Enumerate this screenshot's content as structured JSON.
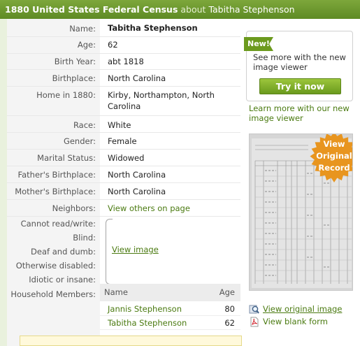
{
  "header": {
    "title": "1880 United States Federal Census",
    "about": "about",
    "person": "Tabitha Stephenson"
  },
  "record": [
    {
      "label": "Name:",
      "value": "Tabitha Stephenson"
    },
    {
      "label": "Age:",
      "value": "62"
    },
    {
      "label": "Birth Year:",
      "value": "abt 1818"
    },
    {
      "label": "Birthplace:",
      "value": "North Carolina"
    },
    {
      "label": "Home in 1880:",
      "value": "Kirby, Northampton, North Carolina"
    },
    {
      "label": "Race:",
      "value": "White"
    },
    {
      "label": "Gender:",
      "value": "Female"
    },
    {
      "label": "Marital Status:",
      "value": "Widowed"
    },
    {
      "label": "Father's Birthplace:",
      "value": "North Carolina"
    },
    {
      "label": "Mother's Birthplace:",
      "value": "North Carolina"
    },
    {
      "label": "Neighbors:",
      "value": "View others on page"
    }
  ],
  "disabilities": {
    "labels": [
      "Cannot read/write:",
      "Blind:",
      "Deaf and dumb:",
      "Otherwise disabled:",
      "Idiotic or insane:"
    ],
    "link": "View image"
  },
  "household": {
    "label": "Household Members:",
    "col_name": "Name",
    "col_age": "Age",
    "members": [
      {
        "name": "Jannis Stephenson",
        "age": "80"
      },
      {
        "name": "Tabitha Stephenson",
        "age": "62"
      }
    ]
  },
  "promo": {
    "badge": "New!",
    "text": "See more with the new image viewer",
    "button": "Try it now",
    "learn_more": "Learn more with our new image viewer"
  },
  "thumbnail": {
    "seal": [
      "View",
      "Original",
      "Record"
    ]
  },
  "links": {
    "view_original": "View original image",
    "view_blank": "View blank form"
  },
  "colors": {
    "header_green": "#6b9a2c",
    "link_green": "#4a7a10",
    "seal_orange": "#e8951f"
  }
}
